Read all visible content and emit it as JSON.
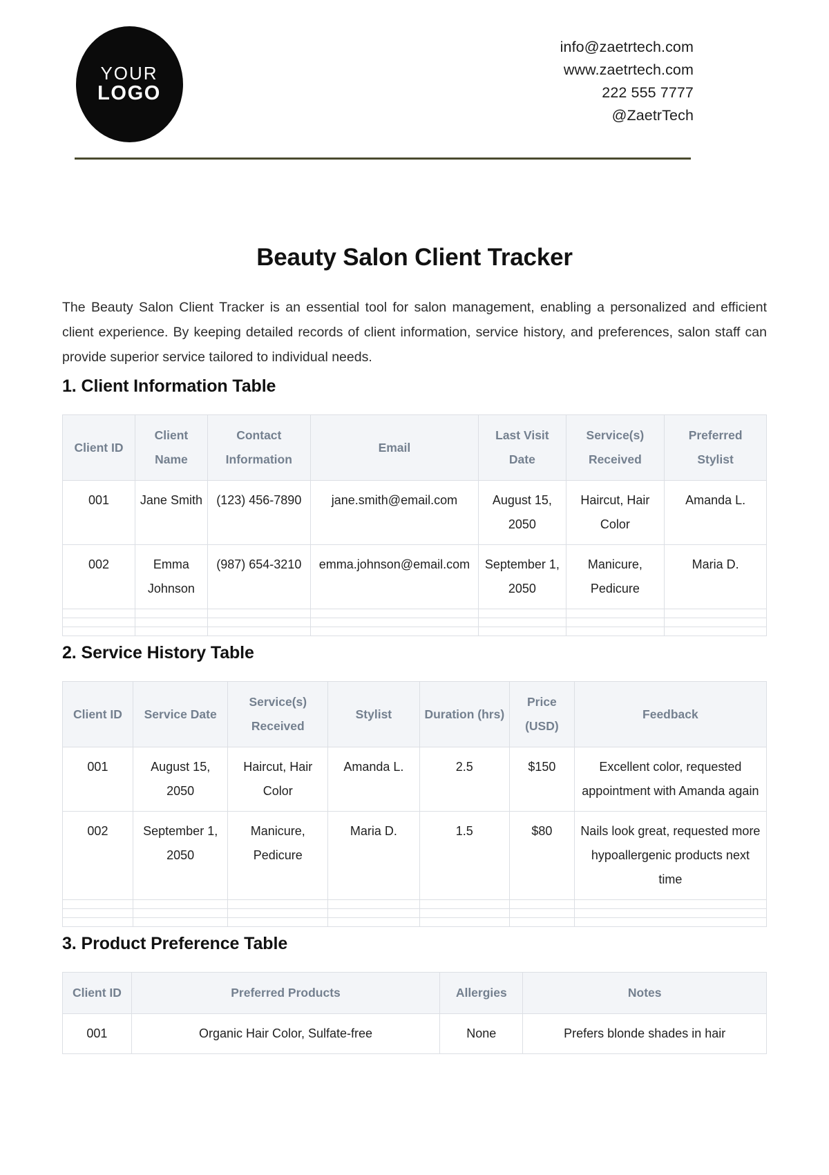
{
  "header": {
    "logo": {
      "line1": "YOUR",
      "line2": "LOGO"
    },
    "contact": [
      "info@zaetrtech.com",
      "www.zaetrtech.com",
      "222 555 7777",
      "@ZaetrTech"
    ],
    "rule_color": "#4a4a2e"
  },
  "document": {
    "title": "Beauty Salon Client Tracker",
    "intro": "The Beauty Salon Client Tracker is an essential tool for salon management, enabling a personalized and efficient client experience. By keeping detailed records of client information, service history, and preferences, salon staff can provide superior service tailored to individual needs."
  },
  "sections": [
    {
      "heading": "1. Client Information Table",
      "columns": [
        "Client ID",
        "Client Name",
        "Contact Information",
        "Email",
        "Last Visit Date",
        "Service(s) Received",
        "Preferred Stylist"
      ],
      "rows": [
        [
          "001",
          "Jane Smith",
          "(123) 456-7890",
          "jane.smith@email.com",
          "August 15, 2050",
          "Haircut, Hair Color",
          "Amanda L."
        ],
        [
          "002",
          "Emma Johnson",
          "(987) 654-3210",
          "emma.johnson@email.com",
          "September 1, 2050",
          "Manicure, Pedicure",
          "Maria D."
        ]
      ],
      "empty_rows": 3
    },
    {
      "heading": "2. Service History Table",
      "columns": [
        "Client ID",
        "Service Date",
        "Service(s) Received",
        "Stylist",
        "Duration (hrs)",
        "Price (USD)",
        "Feedback"
      ],
      "rows": [
        [
          "001",
          "August 15, 2050",
          "Haircut, Hair Color",
          "Amanda L.",
          "2.5",
          "$150",
          "Excellent color, requested appointment with Amanda again"
        ],
        [
          "002",
          "September 1, 2050",
          "Manicure, Pedicure",
          "Maria D.",
          "1.5",
          "$80",
          "Nails look great, requested more hypoallergenic products next time"
        ]
      ],
      "empty_rows": 3
    },
    {
      "heading": "3. Product Preference Table",
      "columns": [
        "Client ID",
        "Preferred Products",
        "Allergies",
        "Notes"
      ],
      "rows": [
        [
          "001",
          "Organic Hair Color, Sulfate-free",
          "None",
          "Prefers blonde shades in hair"
        ]
      ],
      "empty_rows": 0
    }
  ]
}
